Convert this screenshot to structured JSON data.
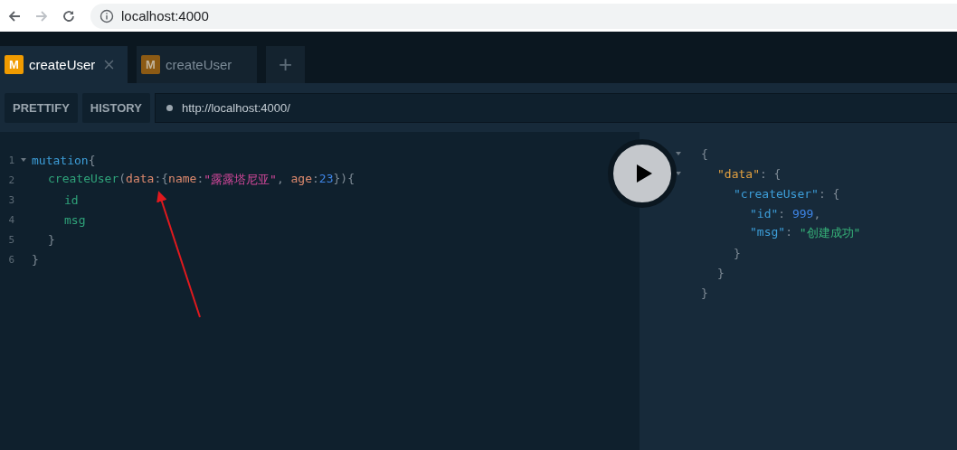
{
  "browser": {
    "address": "localhost:4000"
  },
  "tabs": [
    {
      "badge": "M",
      "label": "createUser",
      "selected": true,
      "closable": true
    },
    {
      "badge": "M",
      "label": "createUser",
      "selected": false,
      "closable": false
    }
  ],
  "new_tab": "+",
  "toolbar": {
    "buttons": [
      "PRETTIFY",
      "HISTORY"
    ],
    "url": "http://localhost:4000/"
  },
  "editor": {
    "lines": [
      {
        "number": "1",
        "foldable": true,
        "tokens": [
          {
            "text": "mutation",
            "kind": "keyword"
          },
          {
            "text": "{",
            "kind": "punct"
          }
        ],
        "children": [
          {
            "number": "2",
            "foldable": false,
            "tokens": [
              {
                "text": "createUser",
                "kind": "field"
              },
              {
                "text": "(",
                "kind": "punct"
              },
              {
                "text": "data",
                "kind": "argument"
              },
              {
                "text": ":{",
                "kind": "punct"
              },
              {
                "text": "name",
                "kind": "argument"
              },
              {
                "text": ":",
                "kind": "punct"
              },
              {
                "text": "\"露露塔尼亚\"",
                "kind": "string"
              },
              {
                "text": ", ",
                "kind": "punct"
              },
              {
                "text": "age",
                "kind": "argument"
              },
              {
                "text": ":",
                "kind": "punct"
              },
              {
                "text": "23",
                "kind": "number"
              },
              {
                "text": "}){",
                "kind": "punct"
              }
            ],
            "children": [
              {
                "number": "3",
                "foldable": false,
                "tokens": [
                  {
                    "text": "id",
                    "kind": "field"
                  }
                ]
              },
              {
                "number": "4",
                "foldable": false,
                "tokens": [
                  {
                    "text": "msg",
                    "kind": "field"
                  }
                ]
              }
            ]
          },
          {
            "number": "5",
            "foldable": false,
            "tokens": [
              {
                "text": "}",
                "kind": "punct"
              }
            ]
          }
        ]
      },
      {
        "number": "6",
        "foldable": false,
        "tokens": [
          {
            "text": "}",
            "kind": "punct"
          }
        ]
      }
    ]
  },
  "result": {
    "lines": [
      {
        "foldable": true,
        "tokens": [
          {
            "text": "{",
            "kind": "punct"
          }
        ],
        "children": [
          {
            "foldable": true,
            "tokens": [
              {
                "text": "\"data\"",
                "kind": "root_key"
              },
              {
                "text": ": {",
                "kind": "punct"
              }
            ],
            "children": [
              {
                "foldable": false,
                "tokens": [
                  {
                    "text": "\"createUser\"",
                    "kind": "key"
                  },
                  {
                    "text": ": {",
                    "kind": "punct"
                  }
                ],
                "children": [
                  {
                    "foldable": false,
                    "tokens": [
                      {
                        "text": "\"id\"",
                        "kind": "key"
                      },
                      {
                        "text": ": ",
                        "kind": "punct"
                      },
                      {
                        "text": "999",
                        "kind": "number"
                      },
                      {
                        "text": ",",
                        "kind": "punct"
                      }
                    ]
                  },
                  {
                    "foldable": false,
                    "tokens": [
                      {
                        "text": "\"msg\"",
                        "kind": "key"
                      },
                      {
                        "text": ": ",
                        "kind": "punct"
                      },
                      {
                        "text": "\"创建成功\"",
                        "kind": "string_result"
                      }
                    ]
                  }
                ]
              },
              {
                "foldable": false,
                "tokens": [
                  {
                    "text": "}",
                    "kind": "punct"
                  }
                ]
              }
            ]
          },
          {
            "foldable": false,
            "tokens": [
              {
                "text": "}",
                "kind": "punct"
              }
            ]
          }
        ]
      },
      {
        "foldable": false,
        "tokens": [
          {
            "text": "}",
            "kind": "punct"
          }
        ]
      }
    ]
  }
}
